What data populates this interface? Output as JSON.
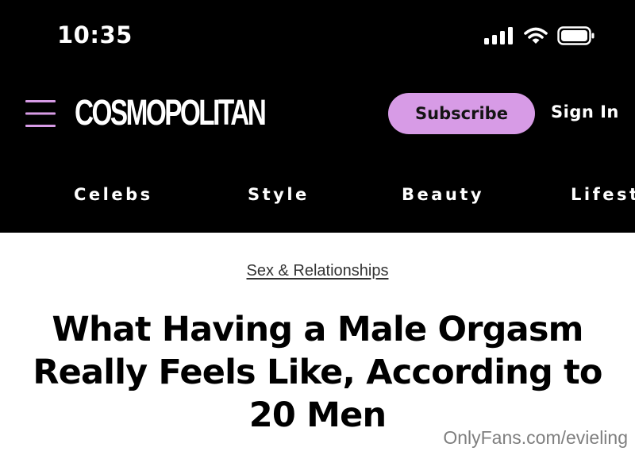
{
  "status_bar": {
    "time": "10:35",
    "icons": [
      "cellular-signal-icon",
      "wifi-icon",
      "battery-icon"
    ]
  },
  "header": {
    "logo": "COSMOPOLITAN",
    "subscribe_label": "Subscribe",
    "signin_label": "Sign In",
    "menu_icon": "hamburger-menu-icon"
  },
  "nav": {
    "tabs": [
      {
        "label": "Celebs"
      },
      {
        "label": "Style"
      },
      {
        "label": "Beauty"
      },
      {
        "label": "Lifest"
      }
    ]
  },
  "article": {
    "category": "Sex & Relationships",
    "title_lines": [
      "What Having a Male Orgasm",
      "Really Feels Like, According to",
      "20 Men"
    ]
  },
  "watermark": "OnlyFans.com/evieling",
  "colors": {
    "header_bg": "#000000",
    "accent": "#d79be6",
    "page_bg": "#ffffff"
  }
}
